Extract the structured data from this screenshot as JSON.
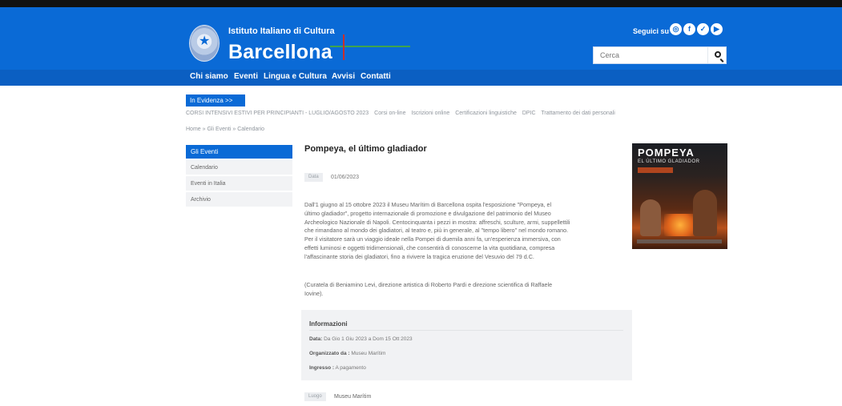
{
  "header": {
    "institute": "Istituto Italiano di Cultura",
    "city": "Barcellona",
    "follow_label": "Seguici su",
    "search_placeholder": "Cerca",
    "brand_color": "#0a6ad6"
  },
  "nav": {
    "items": [
      "Chi siamo",
      "Eventi",
      "Lingua e Cultura",
      "Avvisi",
      "Contatti"
    ]
  },
  "evidence_button": "In Evidenza >>",
  "quick_links": [
    "CORSI INTENSIVI ESTIVI PER PRINCIPIANTI - LUGLIO/AGOSTO 2023",
    "Corsi on-line",
    "Iscrizioni online",
    "Certificazioni linguistiche",
    "DPIC",
    "Trattamento dei dati personali"
  ],
  "breadcrumb": "Home » Gli Eventi » Calendario",
  "sidebar": {
    "heading": "Gli Eventi",
    "items": [
      "Calendario",
      "Eventi in Italia",
      "Archivio"
    ]
  },
  "article": {
    "title": "Pompeya, el último gladiador",
    "date_tag": "Data",
    "date": "01/06/2023",
    "paragraphs": [
      "Dall'1 giugno al 15 ottobre 2023 il Museu Marítim di Barcellona ospita l'esposizione \"Pompeya, el",
      "último gladiador\", progetto internazionale di promozione e divulgazione del patrimonio del Museo",
      "Archeologico Nazionale di Napoli. Centocinquanta i pezzi in mostra: affreschi, sculture, armi, suppellettili",
      "che rimandano al mondo dei gladiatori, al teatro e, più in generale, al \"tempo libero\" nel mondo romano.",
      "Per il visitatore sarà un viaggio ideale nella Pompei di duemila anni fa, un'esperienza immersiva, con",
      "effetti luminosi e oggetti tridimensionali, che consentirà di conoscerne la vita quotidiana, compresa",
      "l'affascinante storia dei gladiatori, fino a rivivere la tragica eruzione del Vesuvio del 79 d.C."
    ],
    "credits": [
      "(Curatela di Beniamino Levi, direzione artistica di Roberto Pardi e direzione scientifica di Raffaele",
      "Iovine)."
    ],
    "info": {
      "heading": "Informazioni",
      "date_label": "Data:",
      "date_value": "Da Gio 1 Giu 2023 a Dom 15 Ott 2023",
      "org_label": "Organizzato da :",
      "org_value": "Museu Marítim",
      "entry_label": "Ingresso :",
      "entry_value": "A pagamento"
    },
    "place_tag": "Luogo",
    "place": "Museu Marítim"
  },
  "poster": {
    "title": "POMPEYA",
    "subtitle": "EL ÚLTIMO GLADIADOR"
  }
}
